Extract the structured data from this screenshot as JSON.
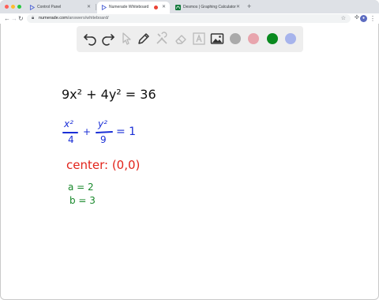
{
  "browser": {
    "tabs": [
      {
        "label": "Control Panel",
        "active": false,
        "recording": false
      },
      {
        "label": "Numerade Whiteboard",
        "active": true,
        "recording": true
      },
      {
        "label": "Desmos | Graphing Calculator",
        "active": false,
        "recording": false
      }
    ],
    "new_tab_icon": "plus-icon",
    "url_host": "numerade.com",
    "url_path": "/answers/whiteboard/"
  },
  "whiteboard": {
    "tools": [
      {
        "name": "undo-icon"
      },
      {
        "name": "redo-icon"
      },
      {
        "name": "select-pointer-icon"
      },
      {
        "name": "pen-icon"
      },
      {
        "name": "tools-icon"
      },
      {
        "name": "eraser-icon"
      },
      {
        "name": "text-icon"
      },
      {
        "name": "image-icon"
      }
    ],
    "colors": [
      "#aaaaaa",
      "#e8a5ad",
      "#0a8a1f",
      "#a7b4ec"
    ],
    "selected_color": "#0a8a1f"
  },
  "canvas": {
    "line1": "9x² + 4y² = 36",
    "line2_num1": "x²",
    "line2_den1": "4",
    "line2_plus": "+",
    "line2_num2": "y²",
    "line2_den2": "9",
    "line2_rhs": "= 1",
    "center_text": "center: (0,0)",
    "a_text": "a = 2",
    "b_text": "b = 3",
    "ink_colors": {
      "black": "#111111",
      "blue": "#1a2fd6",
      "red": "#e2231a",
      "green": "#17882a"
    }
  }
}
